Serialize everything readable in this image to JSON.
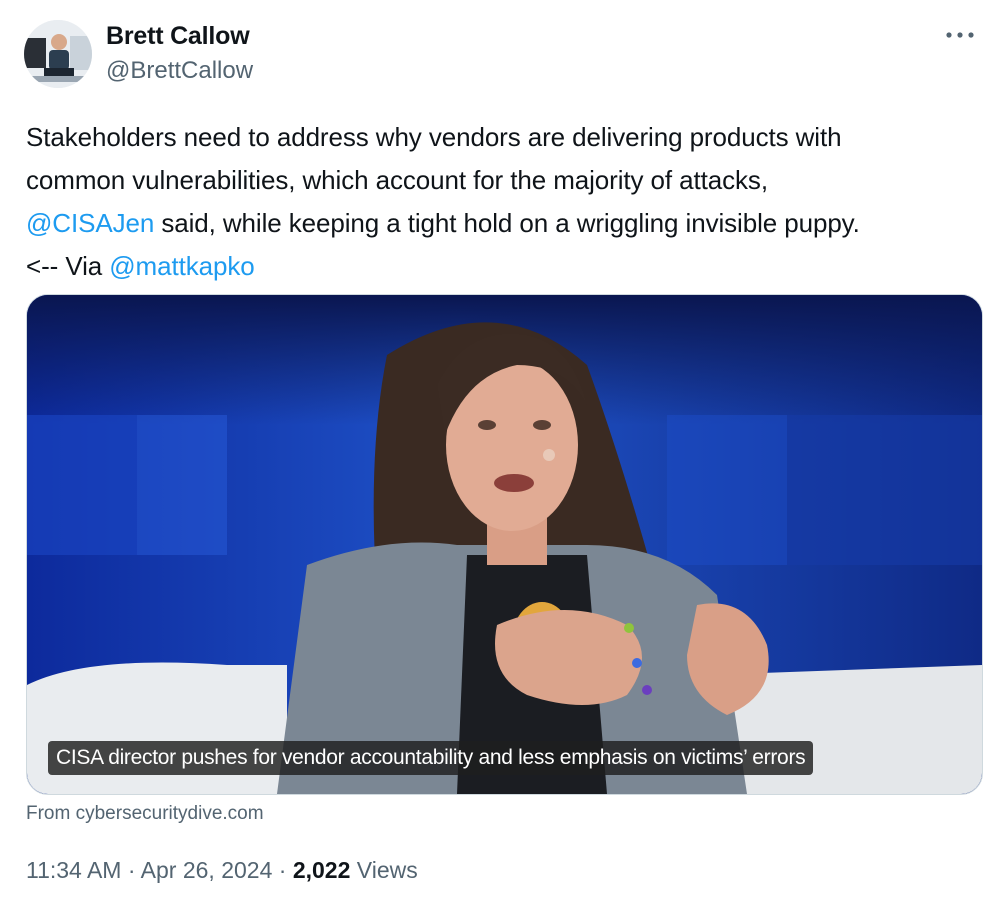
{
  "author": {
    "name": "Brett Callow",
    "handle": "@BrettCallow",
    "avatar_icon": "person-avatar"
  },
  "more_icon": "ellipsis-icon",
  "tweet": {
    "line1": "Stakeholders need to address why vendors are delivering products with",
    "line2": "common vulnerabilities, which account for the majority of attacks,",
    "mention1": "@CISAJen",
    "line3_rest": " said, while keeping a tight hold on a wriggling invisible puppy.",
    "line4_prefix": "<-- Via ",
    "mention2": "@mattkapko"
  },
  "media": {
    "caption": "CISA director pushes for vendor accountability and less emphasis on victims’ errors",
    "source": "From cybersecuritydive.com"
  },
  "meta": {
    "time": "11:34 AM",
    "separator": " · ",
    "date": "Apr 26, 2024",
    "views_count": "2,022",
    "views_label": "Views"
  },
  "colors": {
    "link": "#1d9bf0",
    "secondary_text": "#536471",
    "primary_text": "#0f1419"
  }
}
